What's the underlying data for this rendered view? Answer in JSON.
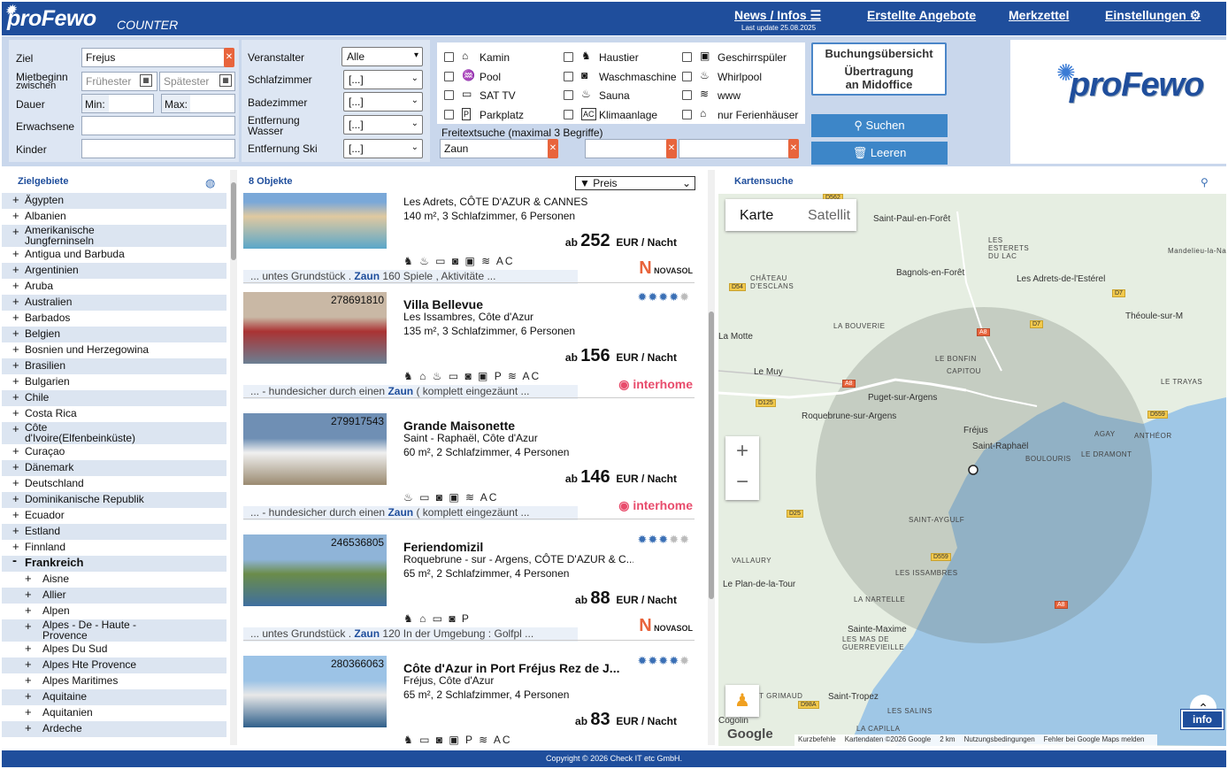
{
  "app": {
    "logo": "proFewo",
    "logo_sub": "COUNTER",
    "brand_color": "#1f4e9c"
  },
  "nav": {
    "news": "News / Infos",
    "news_sub": "Last update 25.08.2025",
    "angebote": "Erstellte Angebote",
    "merkzettel": "Merkzettel",
    "einstellungen": "Einstellungen"
  },
  "search": {
    "ziel_label": "Ziel",
    "ziel_value": "Frejus",
    "mietbeginn_label1": "Mietbeginn",
    "mietbeginn_label2": "zwischen",
    "fruehester": "Frühester",
    "spaetester": "Spätester",
    "dauer_label": "Dauer",
    "min_label": "Min:",
    "max_label": "Max:",
    "erwachsene_label": "Erwachsene",
    "kinder_label": "Kinder",
    "veranstalter_label": "Veranstalter",
    "veranstalter_value": "Alle",
    "schlafzimmer_label": "Schlafzimmer",
    "schlafzimmer_value": "[...]",
    "badezimmer_label": "Badezimmer",
    "badezimmer_value": "[...]",
    "entfwasser_label1": "Entfernung",
    "entfwasser_label2": "Wasser",
    "entfwasser_value": "[...]",
    "entfski_label": "Entfernung Ski",
    "entfski_value": "[...]",
    "amenities": [
      {
        "label": "Kamin",
        "icon": "fireplace-icon",
        "glyph": "⌂"
      },
      {
        "label": "Haustier",
        "icon": "pet-icon",
        "glyph": "♞"
      },
      {
        "label": "Geschirrspüler",
        "icon": "dishwasher-icon",
        "glyph": "▣"
      },
      {
        "label": "Pool",
        "icon": "pool-icon",
        "glyph": "♒"
      },
      {
        "label": "Waschmaschine",
        "icon": "washer-icon",
        "glyph": "◙"
      },
      {
        "label": "Whirlpool",
        "icon": "whirlpool-icon",
        "glyph": "♨"
      },
      {
        "label": "SAT TV",
        "icon": "tv-icon",
        "glyph": "▭"
      },
      {
        "label": "Sauna",
        "icon": "sauna-icon",
        "glyph": "♨"
      },
      {
        "label": "www",
        "icon": "wifi-icon",
        "glyph": "≋"
      },
      {
        "label": "Parkplatz",
        "icon": "parking-icon",
        "glyph": "P"
      },
      {
        "label": "Klimaanlage",
        "icon": "ac-icon",
        "glyph": "AC"
      },
      {
        "label": "nur Ferienhäuser",
        "icon": "house-icon",
        "glyph": "⌂"
      }
    ],
    "freitext_label": "Freitextsuche (maximal 3 Begriffe)",
    "freitext1": "Zaun",
    "buchung_title": "Buchungsübersicht",
    "buchung_l1": "Übertragung",
    "buchung_l2": "an Midoffice",
    "suchen": "Suchen",
    "leeren": "Leeren"
  },
  "left": {
    "header": "Zielgebiete",
    "items": [
      {
        "label": "Ägypten",
        "level": 0,
        "sign": "+"
      },
      {
        "label": "Albanien",
        "level": 0,
        "sign": "+"
      },
      {
        "label": "Amerikanische Jungferninseln",
        "level": 0,
        "sign": "+",
        "lines": [
          "Amerikanische",
          "Jungferninseln"
        ]
      },
      {
        "label": "Antigua und Barbuda",
        "level": 0,
        "sign": "+"
      },
      {
        "label": "Argentinien",
        "level": 0,
        "sign": "+"
      },
      {
        "label": "Aruba",
        "level": 0,
        "sign": "+"
      },
      {
        "label": "Australien",
        "level": 0,
        "sign": "+"
      },
      {
        "label": "Barbados",
        "level": 0,
        "sign": "+"
      },
      {
        "label": "Belgien",
        "level": 0,
        "sign": "+"
      },
      {
        "label": "Bosnien und Herzegowina",
        "level": 0,
        "sign": "+"
      },
      {
        "label": "Brasilien",
        "level": 0,
        "sign": "+"
      },
      {
        "label": "Bulgarien",
        "level": 0,
        "sign": "+"
      },
      {
        "label": "Chile",
        "level": 0,
        "sign": "+"
      },
      {
        "label": "Costa Rica",
        "level": 0,
        "sign": "+"
      },
      {
        "label": "Côte d'Ivoire(Elfenbeinküste)",
        "level": 0,
        "sign": "+",
        "lines": [
          "Côte",
          "d'Ivoire(Elfenbeinküste)"
        ]
      },
      {
        "label": "Curaçao",
        "level": 0,
        "sign": "+"
      },
      {
        "label": "Dänemark",
        "level": 0,
        "sign": "+"
      },
      {
        "label": "Deutschland",
        "level": 0,
        "sign": "+"
      },
      {
        "label": "Dominikanische Republik",
        "level": 0,
        "sign": "+"
      },
      {
        "label": "Ecuador",
        "level": 0,
        "sign": "+"
      },
      {
        "label": "Estland",
        "level": 0,
        "sign": "+"
      },
      {
        "label": "Finnland",
        "level": 0,
        "sign": "+"
      },
      {
        "label": "Frankreich",
        "level": 0,
        "sign": "-",
        "bold": true
      },
      {
        "label": "Aisne",
        "level": 1,
        "sign": "+"
      },
      {
        "label": "Allier",
        "level": 1,
        "sign": "+"
      },
      {
        "label": "Alpen",
        "level": 1,
        "sign": "+"
      },
      {
        "label": "Alpes - De - Haute - Provence",
        "level": 1,
        "sign": "+",
        "lines": [
          "Alpes - De - Haute -",
          "Provence"
        ]
      },
      {
        "label": "Alpes Du Sud",
        "level": 1,
        "sign": "+"
      },
      {
        "label": "Alpes Hte Provence",
        "level": 1,
        "sign": "+"
      },
      {
        "label": "Alpes Maritimes",
        "level": 1,
        "sign": "+"
      },
      {
        "label": "Aquitaine",
        "level": 1,
        "sign": "+"
      },
      {
        "label": "Aquitanien",
        "level": 1,
        "sign": "+"
      },
      {
        "label": "Ardeche",
        "level": 1,
        "sign": "+"
      }
    ]
  },
  "results": {
    "count_label": "8 Objekte",
    "sort_label": "▼ Preis",
    "items": [
      {
        "id": "",
        "title": "",
        "location": "Les Adrets, CÔTE D'AZUR & CANNES",
        "size": "140 m², 3 Schlafzimmer, 6 Personen",
        "price_prefix": "ab",
        "price": "252",
        "price_suffix": "EUR / Nacht",
        "stars": 0,
        "icons": "♞ ♨ ▭ ◙ ▣ ≋ AC",
        "snippet_pre": "... untes Grundstück . ",
        "snippet_hit": "Zaun",
        "snippet_post": " 160 Spiele , Aktivitäte ...",
        "provider": "NOVASOL"
      },
      {
        "id": "278691810",
        "title": "Villa Bellevue",
        "location": "Les Issambres, Côte d'Azur",
        "size": "135 m², 3 Schlafzimmer, 6 Personen",
        "price_prefix": "ab",
        "price": "156",
        "price_suffix": "EUR / Nacht",
        "stars": 4,
        "icons": "♞ ⌂ ♨ ▭ ◙ ▣ P ≋ AC",
        "snippet_pre": "... - hundesicher durch einen ",
        "snippet_hit": "Zaun",
        "snippet_post": " ( komplett eingezäunt ...",
        "provider": "interhome"
      },
      {
        "id": "279917543",
        "title": "Grande Maisonette",
        "location": "Saint - Raphaël, Côte d'Azur",
        "size": "60 m², 2 Schlafzimmer, 4 Personen",
        "price_prefix": "ab",
        "price": "146",
        "price_suffix": "EUR / Nacht",
        "stars": 0,
        "icons": "♨ ▭ ◙ ▣ ≋ AC",
        "snippet_pre": "... - hundesicher durch einen ",
        "snippet_hit": "Zaun",
        "snippet_post": " ( komplett eingezäunt ...",
        "provider": "interhome"
      },
      {
        "id": "246536805",
        "title": "Feriendomizil",
        "location": "Roquebrune - sur - Argens, CÔTE D'AZUR & C...",
        "size": "65 m², 2 Schlafzimmer, 4 Personen",
        "price_prefix": "ab",
        "price": "88",
        "price_suffix": "EUR / Nacht",
        "stars": 3,
        "icons": "♞ ⌂ ▭ ◙ P",
        "snippet_pre": "... untes Grundstück . ",
        "snippet_hit": "Zaun",
        "snippet_post": " 120 In der Umgebung : Golfpl ...",
        "provider": "NOVASOL"
      },
      {
        "id": "280366063",
        "title": "Côte d'Azur in Port Fréjus Rez de J...",
        "location": "Fréjus, Côte d'Azur",
        "size": "65 m², 2 Schlafzimmer, 4 Personen",
        "price_prefix": "ab",
        "price": "83",
        "price_suffix": "EUR / Nacht",
        "stars": 4,
        "icons": "♞ ▭ ◙ ▣ P ≋ AC",
        "snippet_pre": "",
        "snippet_hit": "",
        "snippet_post": "",
        "provider": ""
      }
    ]
  },
  "map": {
    "header": "Kartensuche",
    "tab_karte": "Karte",
    "tab_satellit": "Satellit",
    "zoom_in": "+",
    "zoom_out": "−",
    "info": "info",
    "places": [
      "Saint-Paul-en-Forêt",
      "LES ESTERETS DU LAC",
      "Mandelieu-la-Nap",
      "Bagnols-en-Forêt",
      "Les Adrets-de-l'Estérel",
      "CHÂTEAU D'ESCLANS",
      "Théoule-sur-M",
      "LA BOUVERIE",
      "La Motte",
      "LE BONFIN",
      "CAPITOU",
      "Le Muy",
      "LE TRAYAS",
      "Puget-sur-Argens",
      "Roquebrune-sur-Argens",
      "Fréjus",
      "AGAY",
      "ANTHÉOR",
      "Saint-Raphaël",
      "BOULOURIS",
      "LE DRAMONT",
      "SAINT-AYGULF",
      "VALLAURY",
      "LES ISSAMBRES",
      "Le Plan-de-la-Tour",
      "LA NARTELLE",
      "Sainte-Maxime",
      "LES MAS DE GUERREVIEILLE",
      "Saint-Tropez",
      "RT GRIMAUD",
      "LES SALINS",
      "LA CAPILLA",
      "Cogolin"
    ],
    "roads": [
      "D562",
      "D54",
      "A8",
      "D7",
      "A8",
      "D7",
      "D125",
      "D559",
      "D25",
      "D559",
      "D98A",
      "A8"
    ],
    "attribution": [
      "Kurzbefehle",
      "Kartendaten ©2026 Google",
      "2 km",
      "Nutzungsbedingungen",
      "Fehler bei Google Maps melden"
    ],
    "google": "Google"
  },
  "footer": "Copyright © 2026 Check IT etc GmbH."
}
